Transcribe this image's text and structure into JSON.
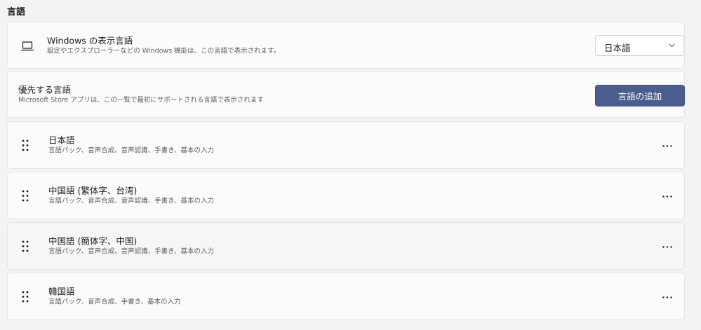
{
  "section": {
    "title": "言語"
  },
  "display_language": {
    "title": "Windows の表示言語",
    "description": "設定やエクスプローラーなどの Windows 機能は、この言語で表示されます。",
    "selected": "日本語"
  },
  "preferred_languages": {
    "title": "優先する言語",
    "description": "Microsoft Store アプリは、この一覧で最初にサポートされる言語で表示されます",
    "add_button_label": "言語の追加",
    "items": [
      {
        "name": "日本語",
        "features": "言語パック、音声合成、音声認識、手書き、基本の入力"
      },
      {
        "name": "中国語 (繁体字、台湾)",
        "features": "言語パック、音声合成、音声認識、手書き、基本の入力"
      },
      {
        "name": "中国語 (簡体字、中国)",
        "features": "言語パック、音声合成、音声認識、手書き、基本の入力"
      },
      {
        "name": "韓国語",
        "features": "言語パック、音声合成、手書き、基本の入力"
      }
    ]
  },
  "icons": {
    "display": "laptop-icon",
    "drag": "grip-dots-icon",
    "more": "more-options-icon",
    "dropdown": "chevron-down-icon"
  },
  "colors": {
    "accent": "#4a5d8c",
    "background": "#f3f3f3",
    "card": "#fbfbfb"
  }
}
